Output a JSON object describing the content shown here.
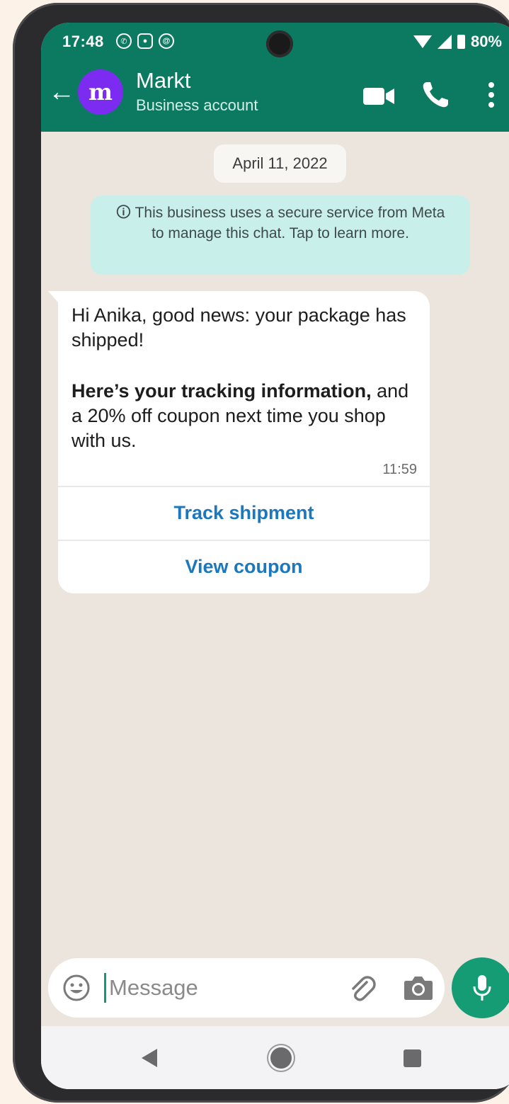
{
  "status_bar": {
    "time": "17:48",
    "battery": "80%",
    "app_icons": [
      "whatsapp-icon",
      "instagram-icon",
      "threads-icon"
    ]
  },
  "header": {
    "back_icon": "arrow-left-icon",
    "avatar_letter": "m",
    "contact_name": "Markt",
    "contact_subtitle": "Business account",
    "actions": [
      "video-call-icon",
      "voice-call-icon",
      "more-vert-icon"
    ]
  },
  "chat": {
    "date": "April 11, 2022",
    "notice": "This business uses a secure service from Meta to manage this chat. Tap to learn more.",
    "message": {
      "line1": "Hi Anika, good news: your package has shipped!",
      "bold": "Here’s your tracking information,",
      "line2": " and a 20% off coupon next time you shop with us.",
      "time": "11:59",
      "buttons": [
        "Track shipment",
        "View coupon"
      ]
    }
  },
  "composer": {
    "placeholder": "Message",
    "value": ""
  },
  "colors": {
    "header_bg": "#0b7a61",
    "chat_bg": "#ece5dd",
    "notice_bg": "#c9efeb",
    "button_text": "#1b78bd",
    "mic_bg": "#169c74",
    "avatar_bg": "#7b2cf0"
  }
}
